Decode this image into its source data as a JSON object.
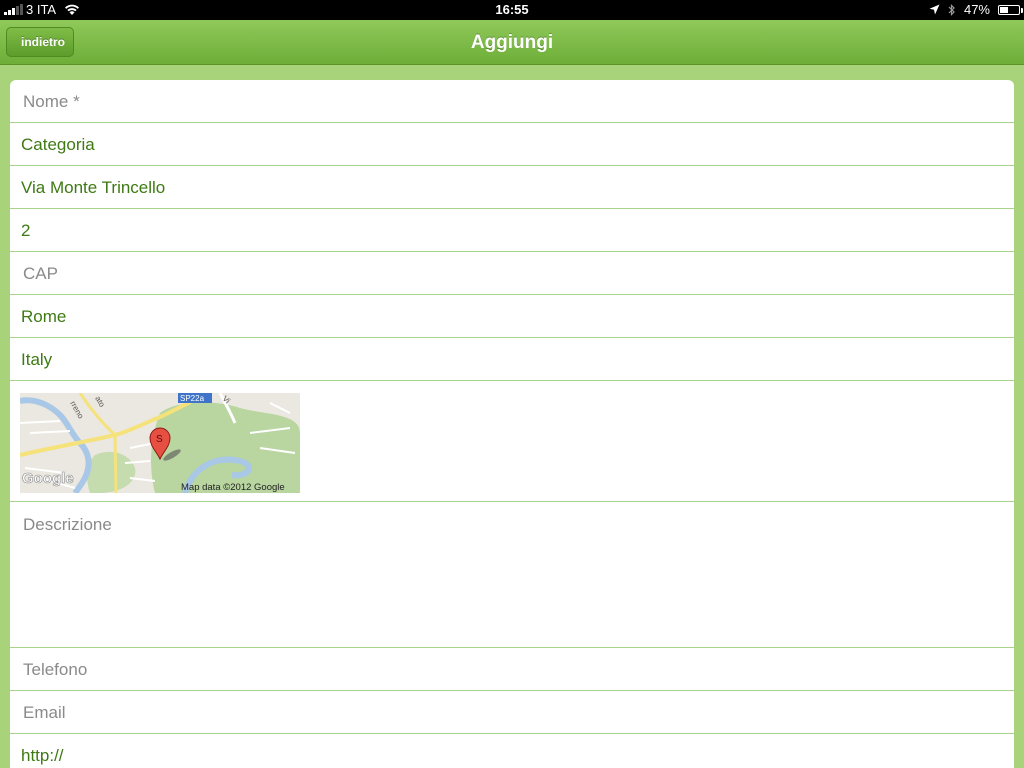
{
  "status": {
    "carrier": "3 ITA",
    "time": "16:55",
    "battery": "47%",
    "battery_level": 0.47
  },
  "nav": {
    "back_label": "indietro",
    "title": "Aggiungi"
  },
  "form": {
    "nome_placeholder": "Nome *",
    "categoria": "Categoria",
    "via": "Via Monte Trincello",
    "numero": "2",
    "cap_placeholder": "CAP",
    "citta": "Rome",
    "paese": "Italy",
    "descrizione_placeholder": "Descrizione",
    "telefono_placeholder": "Telefono",
    "email_placeholder": "Email",
    "web": "http://"
  },
  "map": {
    "road_label": "SP22a",
    "street_label_1": "rreno",
    "street_label_2": "ato",
    "street_label_3": "Vi",
    "pin_letter": "S",
    "logo": "Google",
    "attribution": "Map data ©2012 Google"
  }
}
